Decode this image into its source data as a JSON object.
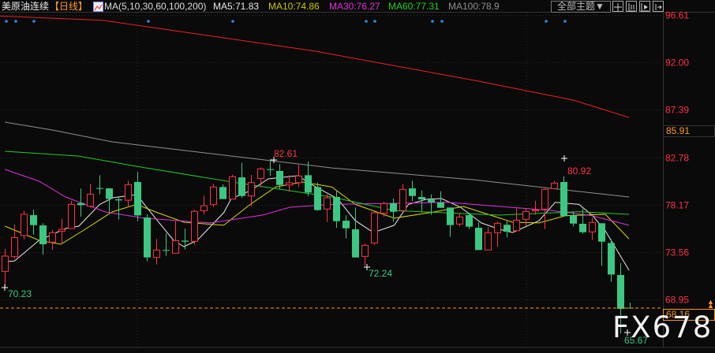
{
  "header": {
    "instrument": "美原油连续",
    "period": "【日线】",
    "indicator": "MA(5,10,30,60,100,200)",
    "ma5": "MA5:71.83",
    "ma10": "MA10:74.86",
    "ma30": "MA30:76.27",
    "ma60": "MA60:77.31",
    "ma100": "MA100:78.9",
    "theme_button": "全部主题▼"
  },
  "toolbar_icons": [
    "crosshair-icon",
    "zoom-range-icon",
    "play-forward-icon",
    "jump-latest-icon"
  ],
  "watermark": "FX678",
  "colors": {
    "up": "#ff3344",
    "down": "#3cc882",
    "ma5": "#e8e8e8",
    "ma10": "#d8d800",
    "ma30": "#e030e0",
    "ma60": "#22cc22",
    "ma100": "#909090",
    "ma200": "#ee2222",
    "current": "#ff9922"
  },
  "chart_data": {
    "type": "candlestick",
    "title": "美原油连续 日线",
    "y_ticks": [
      "96.61",
      "92.00",
      "87.39",
      "82.78",
      "78.17",
      "73.56",
      "68.95"
    ],
    "y_tick_values": [
      96.61,
      92.0,
      87.39,
      82.78,
      78.17,
      73.56,
      68.95
    ],
    "ylim": [
      65.2,
      97.0
    ],
    "highlight_price": "85.91",
    "current_price": "68.16",
    "annotations": {
      "high1": "82.61",
      "low1": "70.23",
      "low2": "72.24",
      "high2": "80.92",
      "low3": "65.67"
    },
    "ohlc": [
      [
        71.7,
        73.87,
        70.23,
        73.18
      ],
      [
        73.13,
        76.24,
        72.92,
        74.98
      ],
      [
        75.17,
        77.59,
        74.79,
        77.24
      ],
      [
        77.16,
        77.7,
        75.27,
        76.19
      ],
      [
        76.16,
        76.37,
        73.31,
        74.33
      ],
      [
        74.53,
        75.73,
        73.77,
        75.45
      ],
      [
        75.6,
        76.83,
        74.38,
        75.78
      ],
      [
        75.86,
        78.54,
        75.81,
        78.21
      ],
      [
        78.33,
        79.74,
        77.01,
        78.13
      ],
      [
        78.03,
        80.2,
        77.9,
        79.2
      ],
      [
        79.79,
        81.04,
        79.18,
        79.74
      ],
      [
        79.76,
        79.76,
        77.39,
        78.74
      ],
      [
        78.69,
        78.92,
        76.73,
        78.59
      ],
      [
        78.61,
        80.5,
        77.9,
        80.12
      ],
      [
        80.38,
        81.35,
        76.57,
        77.13
      ],
      [
        76.93,
        77.26,
        72.67,
        73.05
      ],
      [
        73.05,
        74.84,
        72.36,
        73.77
      ],
      [
        73.77,
        75.4,
        73.2,
        73.69
      ],
      [
        73.46,
        76.57,
        73.46,
        74.68
      ],
      [
        74.68,
        75.86,
        73.82,
        74.58
      ],
      [
        74.61,
        77.7,
        74.28,
        77.52
      ],
      [
        77.59,
        79.05,
        77.26,
        78.08
      ],
      [
        78.18,
        80.21,
        77.95,
        79.89
      ],
      [
        79.89,
        80.15,
        78.72,
        78.72
      ],
      [
        78.72,
        81.09,
        78.72,
        80.89
      ],
      [
        80.83,
        82.24,
        78.84,
        79.02
      ],
      [
        79.02,
        81.06,
        78.03,
        80.32
      ],
      [
        80.73,
        81.8,
        79.89,
        81.65
      ],
      [
        81.63,
        82.61,
        80.96,
        81.55
      ],
      [
        81.45,
        82.11,
        79.69,
        80.09
      ],
      [
        80.09,
        81.04,
        79.43,
        80.3
      ],
      [
        80.32,
        82.03,
        79.89,
        80.96
      ],
      [
        81.04,
        82.37,
        79.02,
        79.35
      ],
      [
        79.89,
        80.32,
        77.59,
        77.65
      ],
      [
        77.75,
        79.18,
        76.5,
        78.84
      ],
      [
        78.92,
        79.56,
        75.93,
        76.57
      ],
      [
        76.62,
        77.13,
        74.89,
        75.88
      ],
      [
        75.78,
        77.9,
        73.05,
        73.05
      ],
      [
        73.15,
        74.4,
        72.24,
        74.23
      ],
      [
        74.45,
        77.52,
        74.28,
        77.39
      ],
      [
        77.34,
        78.46,
        77.01,
        78.28
      ],
      [
        78.31,
        78.79,
        76.5,
        77.49
      ],
      [
        77.59,
        80.2,
        77.59,
        79.66
      ],
      [
        79.76,
        80.5,
        78.54,
        79.02
      ],
      [
        78.92,
        79.56,
        77.44,
        78.69
      ],
      [
        78.67,
        79.18,
        77.19,
        78.41
      ],
      [
        78.39,
        79.48,
        77.87,
        77.87
      ],
      [
        77.9,
        77.9,
        75.04,
        76.19
      ],
      [
        76.29,
        77.39,
        76.06,
        76.98
      ],
      [
        77.16,
        77.39,
        75.81,
        76.04
      ],
      [
        75.93,
        76.45,
        73.77,
        73.77
      ],
      [
        73.77,
        75.99,
        73.77,
        75.45
      ],
      [
        75.45,
        76.55,
        74.07,
        76.37
      ],
      [
        76.22,
        76.62,
        74.99,
        75.55
      ],
      [
        75.65,
        77.8,
        75.6,
        76.67
      ],
      [
        76.75,
        77.77,
        76.11,
        77.52
      ],
      [
        77.57,
        78.54,
        77.19,
        77.67
      ],
      [
        77.75,
        79.74,
        75.81,
        79.66
      ],
      [
        79.74,
        80.5,
        79.74,
        80.27
      ],
      [
        80.38,
        80.92,
        77.06,
        77.06
      ],
      [
        77.13,
        77.52,
        76.06,
        76.34
      ],
      [
        76.32,
        77.77,
        75.35,
        75.5
      ],
      [
        75.53,
        76.88,
        74.76,
        76.45
      ],
      [
        76.37,
        76.37,
        72.23,
        74.58
      ],
      [
        74.45,
        74.84,
        70.68,
        71.39
      ],
      [
        71.34,
        72.49,
        65.67,
        68.05
      ],
      [
        68.16,
        68.66,
        68.1,
        68.13
      ]
    ],
    "ma_series": [
      {
        "name": "MA5",
        "points": [
          [
            0,
            72.64
          ],
          [
            1,
            72.7
          ],
          [
            3.6,
            74.71
          ],
          [
            6.4,
            75.86
          ],
          [
            7.8,
            76.09
          ],
          [
            10,
            78.2
          ],
          [
            11.4,
            78.85
          ],
          [
            13.9,
            79.15
          ],
          [
            16.1,
            76.62
          ],
          [
            17.8,
            74.71
          ],
          [
            18.9,
            74.1
          ],
          [
            20.3,
            74.71
          ],
          [
            23.1,
            77.4
          ],
          [
            23.9,
            78.77
          ],
          [
            25.9,
            79.53
          ],
          [
            27.8,
            80.68
          ],
          [
            30.9,
            80.99
          ],
          [
            32.8,
            79.9
          ],
          [
            34.5,
            79.07
          ],
          [
            35.1,
            78.77
          ],
          [
            37,
            76.62
          ],
          [
            38.9,
            75.47
          ],
          [
            41.1,
            76.17
          ],
          [
            42.6,
            78.2
          ],
          [
            44.5,
            78.7
          ],
          [
            46.1,
            78.77
          ],
          [
            48.1,
            77.93
          ],
          [
            50.3,
            76.4
          ],
          [
            52.2,
            75.78
          ],
          [
            53.6,
            75.47
          ],
          [
            56.4,
            76.62
          ],
          [
            58.1,
            78.4
          ],
          [
            60.6,
            78.2
          ],
          [
            62,
            77.16
          ],
          [
            63.4,
            75.63
          ],
          [
            65.9,
            71.8
          ]
        ]
      },
      {
        "name": "MA10",
        "points": [
          [
            0,
            76.09
          ],
          [
            3.6,
            74.71
          ],
          [
            5.9,
            74.33
          ],
          [
            8.6,
            75.86
          ],
          [
            11.3,
            77.47
          ],
          [
            13.9,
            78.2
          ],
          [
            16.1,
            77.4
          ],
          [
            18.9,
            76.47
          ],
          [
            23.1,
            76.17
          ],
          [
            25.9,
            78.2
          ],
          [
            28.6,
            79.9
          ],
          [
            31.4,
            80.38
          ],
          [
            34.5,
            79.9
          ],
          [
            37,
            78.2
          ],
          [
            41.1,
            76.86
          ],
          [
            45.3,
            77.47
          ],
          [
            48.4,
            78.0
          ],
          [
            53.6,
            76.47
          ],
          [
            56.4,
            76.4
          ],
          [
            59.2,
            77.1
          ],
          [
            63.4,
            77.24
          ],
          [
            65.9,
            74.86
          ]
        ]
      },
      {
        "name": "MA30",
        "points": [
          [
            0,
            81.6
          ],
          [
            3.6,
            80.45
          ],
          [
            6.4,
            78.92
          ],
          [
            10.6,
            77.47
          ],
          [
            14.7,
            76.86
          ],
          [
            21.7,
            76.4
          ],
          [
            27.2,
            77.16
          ],
          [
            30.1,
            77.93
          ],
          [
            34.5,
            78.2
          ],
          [
            46.7,
            78.4
          ],
          [
            52.2,
            78.0
          ],
          [
            57.8,
            77.6
          ],
          [
            62,
            77.1
          ],
          [
            65.9,
            76.17
          ]
        ]
      },
      {
        "name": "MA60",
        "points": [
          [
            0,
            83.36
          ],
          [
            7.8,
            82.9
          ],
          [
            13.9,
            81.9
          ],
          [
            24.5,
            80.3
          ],
          [
            34.5,
            78.92
          ],
          [
            41.1,
            77.6
          ],
          [
            52.2,
            77.16
          ],
          [
            60.6,
            77.5
          ],
          [
            65.9,
            77.24
          ]
        ]
      },
      {
        "name": "MA100",
        "points": [
          [
            0,
            86.2
          ],
          [
            5,
            85.43
          ],
          [
            11.3,
            84.28
          ],
          [
            34.5,
            81.75
          ],
          [
            49.5,
            80.6
          ],
          [
            65.9,
            78.92
          ]
        ]
      },
      {
        "name": "MA200",
        "points": [
          [
            -0.5,
            96.5
          ],
          [
            10.3,
            96.1
          ],
          [
            32.8,
            93.09
          ],
          [
            50,
            90.18
          ],
          [
            60,
            88.34
          ],
          [
            65.9,
            86.65
          ]
        ]
      }
    ]
  }
}
